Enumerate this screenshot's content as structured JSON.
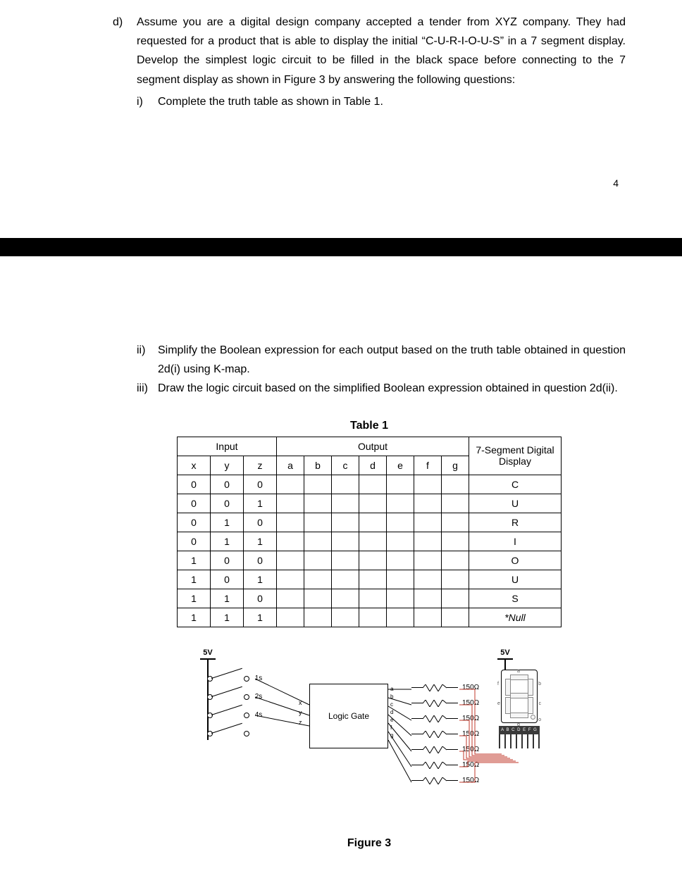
{
  "q": {
    "d_marker": "d)",
    "d_text": "Assume you are a digital design company accepted a tender from XYZ company. They had requested for a product that is able to display the initial “C-U-R-I-O-U-S” in a 7 segment display. Develop the simplest logic circuit to be filled in the black space before connecting to the 7 segment display as shown in Figure 3 by answering the following questions:",
    "i_marker": "i)",
    "i_text": "Complete the truth table as shown in Table 1.",
    "ii_marker": "ii)",
    "ii_text": "Simplify the Boolean expression for each output based on the truth table obtained in question 2d(i) using K-map.",
    "iii_marker": "iii)",
    "iii_text": "Draw the logic circuit based on the simplified Boolean expression obtained in question 2d(ii)."
  },
  "page_number": "4",
  "table": {
    "caption": "Table 1",
    "head_input": "Input",
    "head_output": "Output",
    "head_display": "7-Segment Digital Display",
    "cols_in": [
      "x",
      "y",
      "z"
    ],
    "cols_out": [
      "a",
      "b",
      "c",
      "d",
      "e",
      "f",
      "g"
    ],
    "rows": [
      {
        "in": [
          "0",
          "0",
          "0"
        ],
        "disp": "C"
      },
      {
        "in": [
          "0",
          "0",
          "1"
        ],
        "disp": "U"
      },
      {
        "in": [
          "0",
          "1",
          "0"
        ],
        "disp": "R"
      },
      {
        "in": [
          "0",
          "1",
          "1"
        ],
        "disp": "I"
      },
      {
        "in": [
          "1",
          "0",
          "0"
        ],
        "disp": "O"
      },
      {
        "in": [
          "1",
          "0",
          "1"
        ],
        "disp": "U"
      },
      {
        "in": [
          "1",
          "1",
          "0"
        ],
        "disp": "S"
      },
      {
        "in": [
          "1",
          "1",
          "1"
        ],
        "disp": "*Null"
      }
    ]
  },
  "figure": {
    "caption": "Figure 3",
    "vcc": "5V",
    "switches": [
      "1s",
      "2s",
      "4s"
    ],
    "logic_box": "Logic Gate",
    "logic_in": [
      "x",
      "y",
      "z"
    ],
    "logic_out": [
      "a",
      "b",
      "c",
      "d",
      "e",
      "f",
      "g"
    ],
    "resistor_value": "150Ω",
    "resistor_count": 7,
    "pin_strip": "A B C D E F G",
    "seg_labels": {
      "a": "a",
      "b": "b",
      "c": "c",
      "d": "d",
      "e": "e",
      "f": "f",
      "o": "o"
    }
  }
}
